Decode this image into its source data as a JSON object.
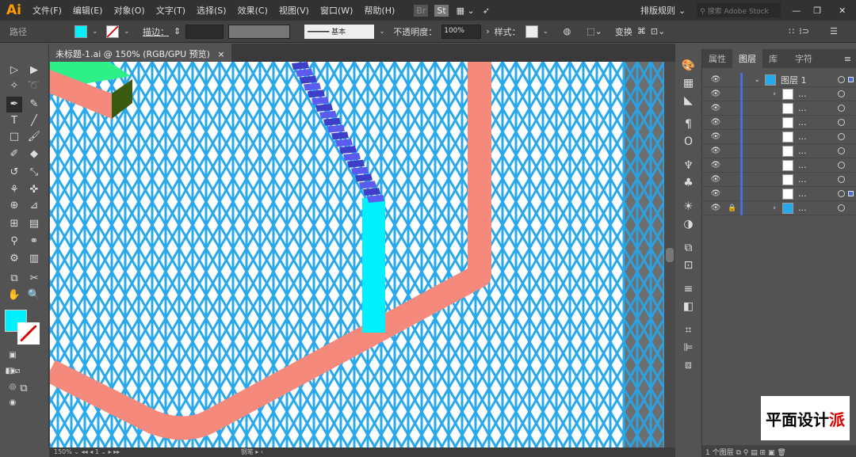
{
  "app": {
    "logo": "Ai"
  },
  "menu": [
    "文件(F)",
    "编辑(E)",
    "对象(O)",
    "文字(T)",
    "选择(S)",
    "效果(C)",
    "视图(V)",
    "窗口(W)",
    "帮助(H)"
  ],
  "topbar": {
    "br": "Br",
    "st": "St",
    "workspace": "排版规则",
    "search_placeholder": "搜索 Adobe Stock"
  },
  "control": {
    "type": "路径",
    "stroke_label": "描边：",
    "brush": "基本",
    "opacity_label": "不透明度：",
    "opacity": "100%",
    "style_label": "样式：",
    "transform": "变换"
  },
  "colors": {
    "fill": "#00f0ff",
    "salmon": "#f58a7c",
    "grid": "#29a8ec",
    "stairs": "#5b5bf0"
  },
  "document": {
    "tab": "未标题-1.ai @ 150% (RGB/GPU 预览)",
    "close": "×"
  },
  "status": {
    "zoom": "150%",
    "page": "1",
    "tool": "钢笔"
  },
  "panel": {
    "tabs": [
      "属性",
      "图层",
      "库",
      "字符"
    ],
    "active": 1,
    "layers": [
      {
        "name": "图层 1",
        "top": true
      },
      {
        "name": "..."
      },
      {
        "name": "..."
      },
      {
        "name": "..."
      },
      {
        "name": "..."
      },
      {
        "name": "..."
      },
      {
        "name": "..."
      },
      {
        "name": "..."
      },
      {
        "name": "..."
      },
      {
        "name": "...",
        "locked": true
      }
    ],
    "footer": "1 个图层"
  },
  "watermark": "平面设计派"
}
